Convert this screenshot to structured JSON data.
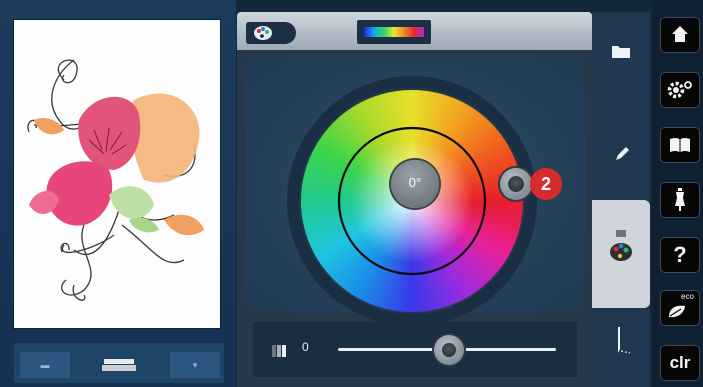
{
  "color_panel": {
    "hue_readout": "0°",
    "slider_value": "0"
  },
  "annotation": {
    "callout_number": "2",
    "color": "#d62c2c"
  },
  "side_tabs": [
    {
      "icon": "folder-icon"
    },
    {
      "icon": "pencil-icon"
    },
    {
      "icon": "color-palette-icon",
      "active": true
    },
    {
      "icon": "needle-icon"
    }
  ],
  "toolbar": {
    "buttons": [
      {
        "icon": "home-icon"
      },
      {
        "icon": "settings-icon"
      },
      {
        "icon": "book-icon"
      },
      {
        "icon": "tutorial-icon"
      },
      {
        "icon": "help-icon",
        "label": "?"
      },
      {
        "icon": "eco-icon",
        "label": "eco"
      },
      {
        "icon": "clear-icon",
        "label": "clr"
      }
    ]
  },
  "colors": {
    "background": "#12283a",
    "panel": "#26384a",
    "toolbar_button": "#070707"
  }
}
